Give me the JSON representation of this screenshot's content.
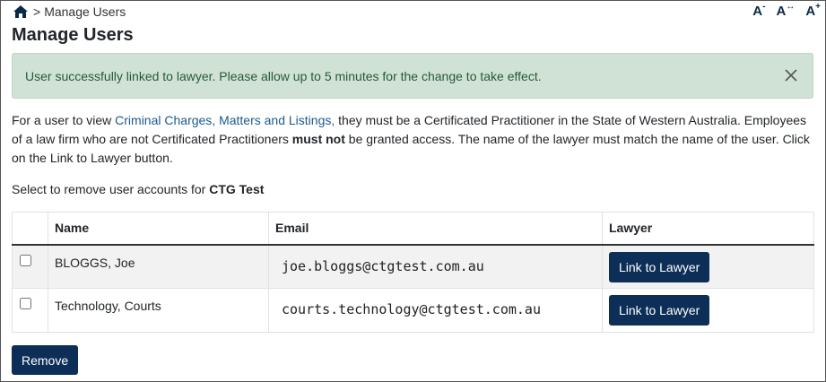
{
  "breadcrumb": {
    "separator": ">",
    "current": "Manage Users"
  },
  "font_controls": {
    "decrease": "A",
    "decrease_mark": "-",
    "reset": "A",
    "reset_mark": "↔",
    "increase": "A",
    "increase_mark": "+"
  },
  "page_title": "Manage Users",
  "alert": {
    "message": "User successfully linked to lawyer. Please allow up to 5 minutes for the change to take effect."
  },
  "intro": {
    "part1": "For a user to view ",
    "link": "Criminal Charges, Matters and Listings,",
    "part2": " they must be a Certificated Practitioner in the State of Western Australia. Employees of a law firm who are not Certificated Practitioners ",
    "bold": "must not",
    "part3": " be granted access. The name of the lawyer must match the name of the user. Click on the Link to Lawyer button."
  },
  "select_line": {
    "prefix": "Select to remove user accounts for ",
    "firm": "CTG Test"
  },
  "table": {
    "headers": {
      "name": "Name",
      "email": "Email",
      "lawyer": "Lawyer"
    },
    "rows": [
      {
        "name": "BLOGGS, Joe",
        "email": "joe.bloggs@ctgtest.com.au",
        "button": "Link to Lawyer"
      },
      {
        "name": "Technology, Courts",
        "email": "courts.technology@ctgtest.com.au",
        "button": "Link to Lawyer"
      }
    ]
  },
  "remove_label": "Remove",
  "colors": {
    "primary": "#0d2f57",
    "alert_bg": "#d0e2d6",
    "alert_text": "#255a35",
    "link": "#1d5a8e"
  }
}
